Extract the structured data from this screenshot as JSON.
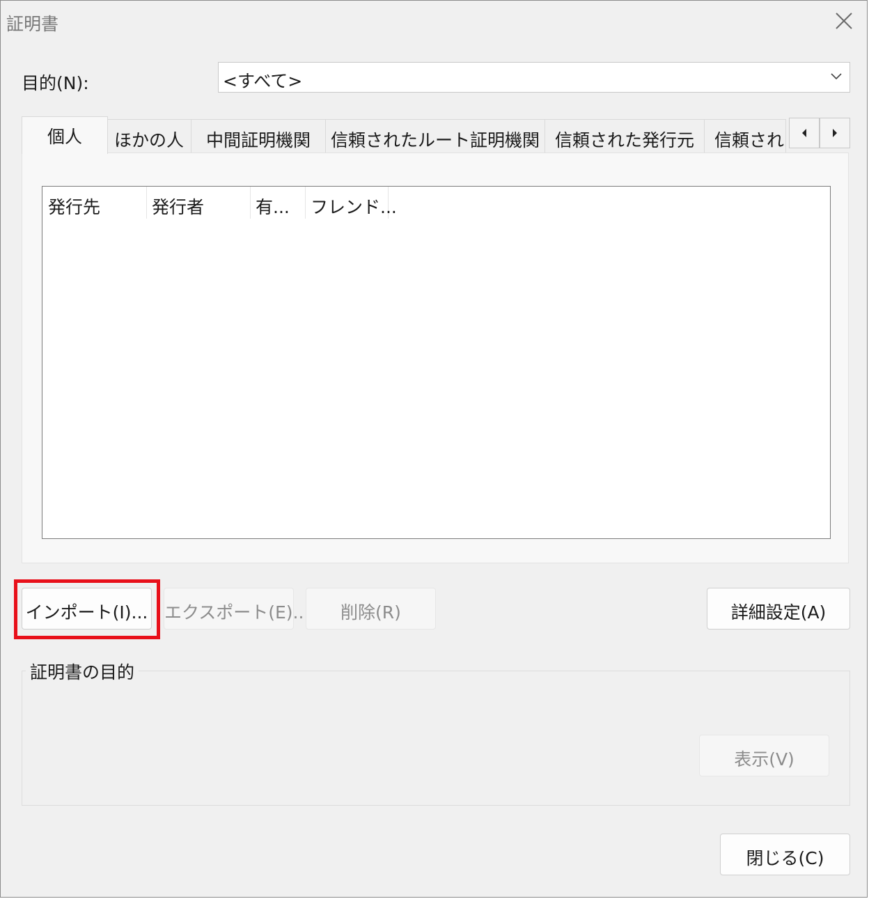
{
  "window": {
    "title": "証明書",
    "close_icon": "close-icon"
  },
  "purpose": {
    "label": "目的(N):",
    "selected": "<すべて>"
  },
  "tabs": [
    {
      "label": "個人",
      "active": true
    },
    {
      "label": "ほかの人",
      "active": false
    },
    {
      "label": "中間証明機関",
      "active": false
    },
    {
      "label": "信頼されたルート証明機関",
      "active": false
    },
    {
      "label": "信頼された発行元",
      "active": false
    },
    {
      "label": "信頼されな",
      "active": false
    }
  ],
  "tab_scroll": {
    "left_icon": "triangle-left-icon",
    "right_icon": "triangle-right-icon"
  },
  "list": {
    "columns": [
      "発行先",
      "発行者",
      "有...",
      "フレンド..."
    ],
    "rows": []
  },
  "buttons": {
    "import": "インポート(I)...",
    "export": "エクスポート(E)...",
    "delete": "削除(R)",
    "advanced": "詳細設定(A)",
    "view": "表示(V)",
    "close": "閉じる(C)"
  },
  "purpose_group": {
    "legend": "証明書の目的"
  },
  "colors": {
    "highlight": "#e8101a",
    "dialog_bg": "#f0f0f0",
    "disabled_text": "#8c8c8c"
  }
}
